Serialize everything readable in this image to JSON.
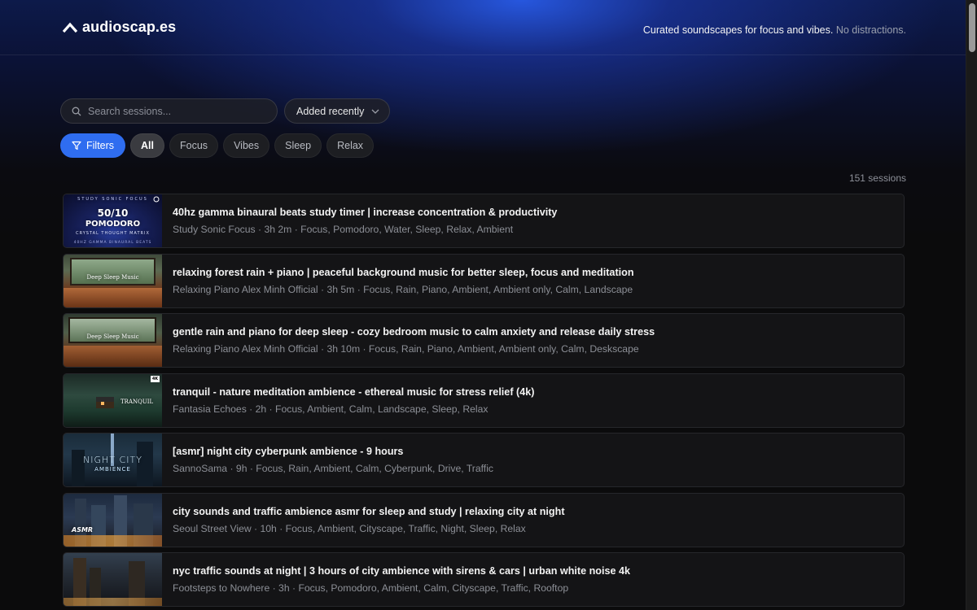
{
  "header": {
    "brand": "audioscap.es",
    "tagline_main": "Curated soundscapes for focus and vibes.",
    "tagline_muted": "No distractions."
  },
  "search": {
    "placeholder": "Search sessions..."
  },
  "sort": {
    "label": "Added recently"
  },
  "filters": {
    "button_label": "Filters",
    "chips": [
      "All",
      "Focus",
      "Vibes",
      "Sleep",
      "Relax"
    ],
    "active": "All"
  },
  "count_text": "151 sessions",
  "sessions": [
    {
      "title": "40hz gamma binaural beats study timer | increase concentration & productivity",
      "meta": "Study Sonic Focus · 3h 2m · Focus, Pomodoro, Water, Sleep, Relax, Ambient",
      "thumb_top": "STUDY SONIC FOCUS",
      "thumb_main": "50/10",
      "thumb_sub": "POMODORO",
      "thumb_caption": "CRYSTAL THOUGHT MATRIX",
      "thumb_bottom": "40HZ GAMMA BINAURAL BEATS"
    },
    {
      "title": "relaxing forest rain + piano | peaceful background music for better sleep, focus and meditation",
      "meta": "Relaxing Piano Alex Minh Official · 3h 5m · Focus, Rain, Piano, Ambient, Ambient only, Calm, Landscape",
      "thumb_main": "Deep Sleep Music"
    },
    {
      "title": "gentle rain and piano for deep sleep - cozy bedroom music to calm anxiety and release daily stress",
      "meta": "Relaxing Piano Alex Minh Official · 3h 10m · Focus, Rain, Piano, Ambient, Ambient only, Calm, Deskscape",
      "thumb_main": "Deep Sleep Music"
    },
    {
      "title": "tranquil - nature meditation ambience - ethereal music for stress relief (4k)",
      "meta": "Fantasia Echoes · 2h · Focus, Ambient, Calm, Landscape, Sleep, Relax",
      "thumb_main": "TRANQUIL",
      "thumb_badge": "4K"
    },
    {
      "title": "[asmr] night city cyberpunk ambience - 9 hours",
      "meta": "SannoSama · 9h · Focus, Rain, Ambient, Calm, Cyberpunk, Drive, Traffic",
      "thumb_main": "NIGHT CITY",
      "thumb_sub": "AMBIENCE"
    },
    {
      "title": "city sounds and traffic ambience asmr for sleep and study | relaxing city at night",
      "meta": "Seoul Street View · 10h · Focus, Ambient, Cityscape, Traffic, Night, Sleep, Relax",
      "thumb_main": "ASMR"
    },
    {
      "title": "nyc traffic sounds at night | 3 hours of city ambience with sirens & cars | urban white noise 4k",
      "meta": "Footsteps to Nowhere · 3h · Focus, Pomodoro, Ambient, Calm, Cityscape, Traffic, Rooftop"
    }
  ]
}
